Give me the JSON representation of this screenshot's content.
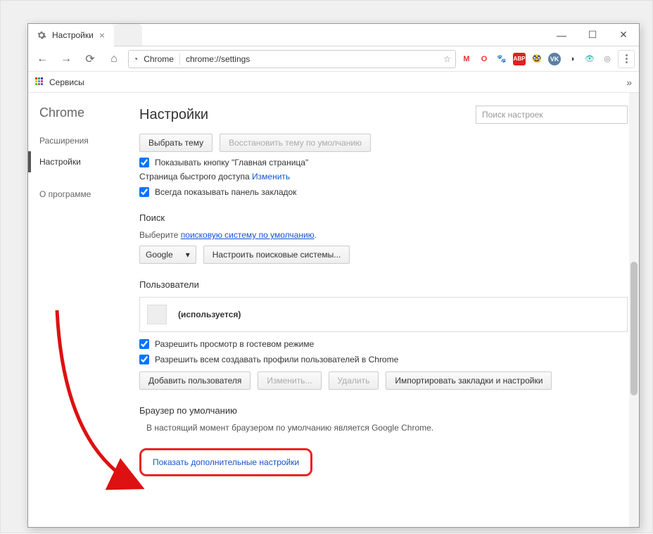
{
  "window": {
    "tab_title": "Настройки"
  },
  "omnibox": {
    "protocol_label": "Chrome",
    "url": "chrome://settings"
  },
  "bookmarks_bar": {
    "services_label": "Сервисы"
  },
  "sidebar": {
    "brand": "Chrome",
    "items": [
      {
        "label": "Расширения"
      },
      {
        "label": "Настройки"
      },
      {
        "label": "О программе"
      }
    ]
  },
  "page": {
    "title": "Настройки",
    "search_placeholder": "Поиск настроек"
  },
  "appearance": {
    "choose_theme": "Выбрать тему",
    "reset_theme": "Восстановить тему по умолчанию",
    "show_home_button": "Показывать кнопку \"Главная страница\"",
    "home_page_line": "Страница быстрого доступа",
    "change_link": "Изменить",
    "show_bookmarks_bar": "Всегда показывать панель закладок"
  },
  "search": {
    "heading": "Поиск",
    "choose_label_prefix": "Выберите",
    "choose_link": "поисковую систему по умолчанию",
    "engine": "Google",
    "manage_btn": "Настроить поисковые системы..."
  },
  "users": {
    "heading": "Пользователи",
    "current_suffix": "(используется)",
    "allow_guest": "Разрешить просмотр в гостевом режиме",
    "allow_add": "Разрешить всем создавать профили пользователей в Chrome",
    "add_btn": "Добавить пользователя",
    "edit_btn": "Изменить...",
    "delete_btn": "Удалить",
    "import_btn": "Импортировать закладки и настройки"
  },
  "default_browser": {
    "heading": "Браузер по умолчанию",
    "status": "В настоящий момент браузером по умолчанию является Google Chrome."
  },
  "advanced_link": "Показать дополнительные настройки",
  "ext_icons": {
    "gmail": "M",
    "opera": "O",
    "paw": "paw",
    "abp": "ABP",
    "mask": "mask",
    "vk": "VK",
    "round1": "●",
    "eye": "eye",
    "round2": "●"
  }
}
